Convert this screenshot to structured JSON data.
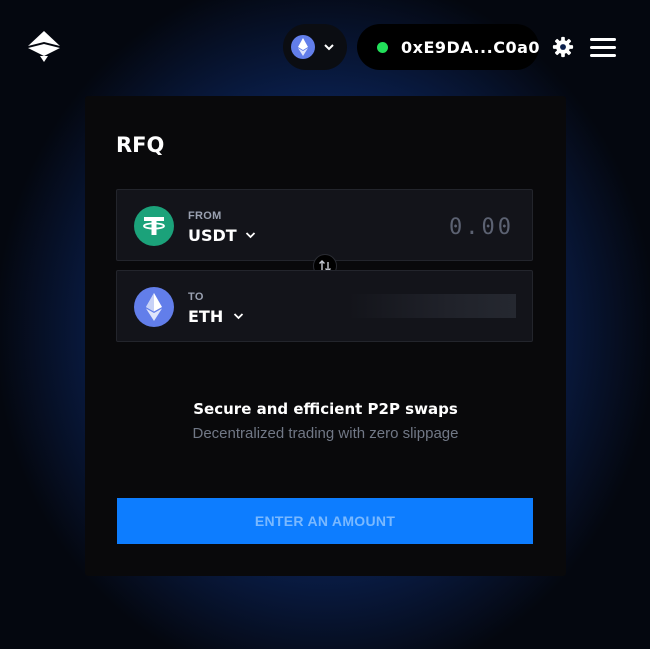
{
  "header": {
    "network": {
      "icon": "ethereum-icon"
    },
    "wallet": {
      "address": "0xE9DA...C0a0",
      "status_color": "#22e05a"
    }
  },
  "card": {
    "title": "RFQ",
    "from": {
      "label": "FROM",
      "symbol": "USDT",
      "icon": "tether-icon",
      "amount_placeholder": "0.00"
    },
    "to": {
      "label": "TO",
      "symbol": "ETH",
      "icon": "ethereum-icon"
    },
    "headline": "Secure and efficient P2P swaps",
    "subline": "Decentralized trading with zero slippage",
    "cta_label": "ENTER AN AMOUNT"
  },
  "colors": {
    "accent": "#0d7dff",
    "card_bg": "#09090b",
    "panel_bg": "#13141a",
    "tether": "#1ba27a",
    "ethereum": "#627eea"
  }
}
